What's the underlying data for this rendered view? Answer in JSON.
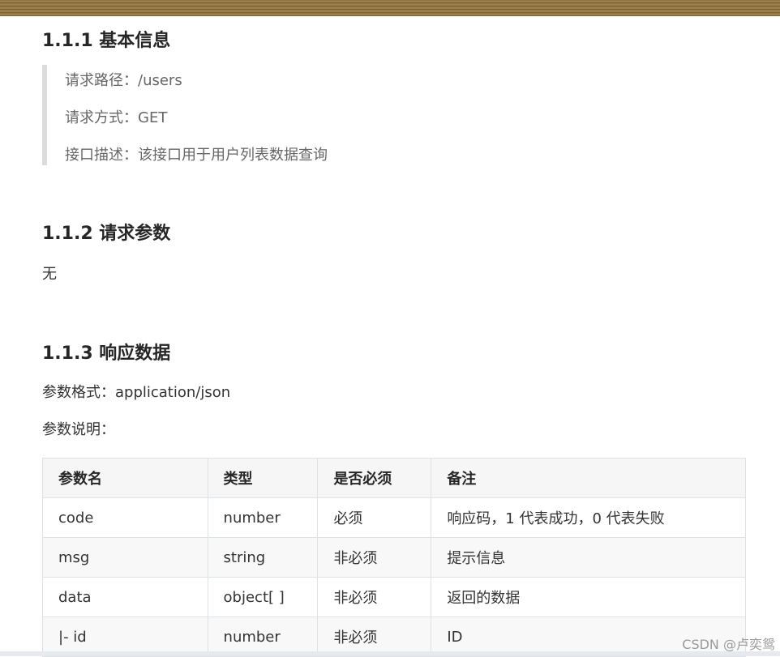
{
  "sections": {
    "basic_title": "1.1.1 基本信息",
    "request_title": "1.1.2 请求参数",
    "response_title": "1.1.3 响应数据"
  },
  "basic_info": {
    "path_line": "请求路径：/users",
    "method_line": "请求方式：GET",
    "desc_line": "接口描述：该接口用于用户列表数据查询"
  },
  "request_params": {
    "text": "无"
  },
  "response": {
    "format_line": "参数格式：application/json",
    "desc_label": "参数说明："
  },
  "table": {
    "headers": [
      "参数名",
      "类型",
      "是否必须",
      "备注"
    ],
    "rows": [
      [
        "code",
        "number",
        "必须",
        "响应码，1 代表成功，0 代表失败"
      ],
      [
        "msg",
        "string",
        "非必须",
        "提示信息"
      ],
      [
        "data",
        "object[ ]",
        "非必须",
        "返回的数据"
      ],
      [
        "|- id",
        "number",
        "非必须",
        "ID"
      ]
    ]
  },
  "watermark": "CSDN @卢奕鸳"
}
